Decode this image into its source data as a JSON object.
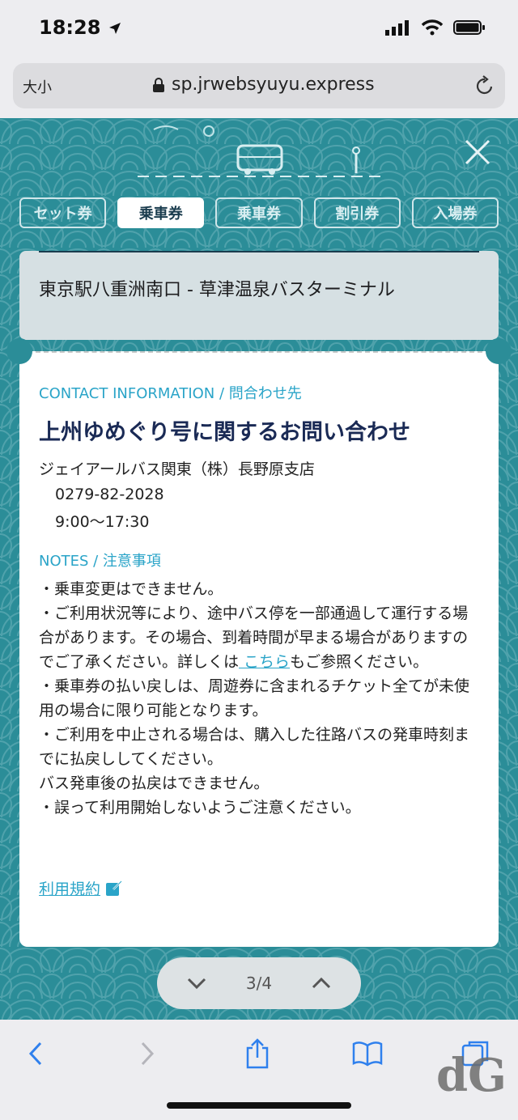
{
  "status_bar": {
    "time": "18:28"
  },
  "address_bar": {
    "text_size_label": "大小",
    "url": "sp.jrwebsyuyu.express"
  },
  "tabs": [
    {
      "label": "セット券",
      "active": false
    },
    {
      "label": "乗車券",
      "active": true
    },
    {
      "label": "乗車券",
      "active": false
    },
    {
      "label": "割引券",
      "active": false
    },
    {
      "label": "入場券",
      "active": false
    }
  ],
  "route": {
    "title": "東京駅八重洲南口 - 草津温泉バスターミナル"
  },
  "contact": {
    "section_label": "CONTACT INFORMATION / 問合わせ先",
    "title": "上州ゆめぐり号に関するお問い合わせ",
    "company": "ジェイアールバス関東（株）長野原支店",
    "phone": "0279-82-2028",
    "hours": "9:00〜17:30"
  },
  "notes": {
    "section_label": "NOTES / 注意事項",
    "line1": "・乗車変更はできません。",
    "line2_pre": "・ご利用状況等により、途中バス停を一部通過して運行する場合があります。その場合、到着時間が早まる場合がありますのでご了承ください。詳しくは",
    "line2_link": " こちら",
    "line2_post": "もご参照ください。",
    "line3": "・乗車券の払い戻しは、周遊券に含まれるチケット全てが未使用の場合に限り可能となります。",
    "line4": "・ご利用を中止される場合は、購入した往路バスの発車時刻までに払戻ししてください。",
    "line5": "バス発車後の払戻はできません。",
    "line6": "・誤って利用開始しないようご注意ください。"
  },
  "terms": {
    "label": "利用規約"
  },
  "pager": {
    "count": "3/4"
  },
  "colors": {
    "teal": "#2b8d98",
    "accent": "#2aa4c8",
    "navy": "#1a2a55"
  }
}
